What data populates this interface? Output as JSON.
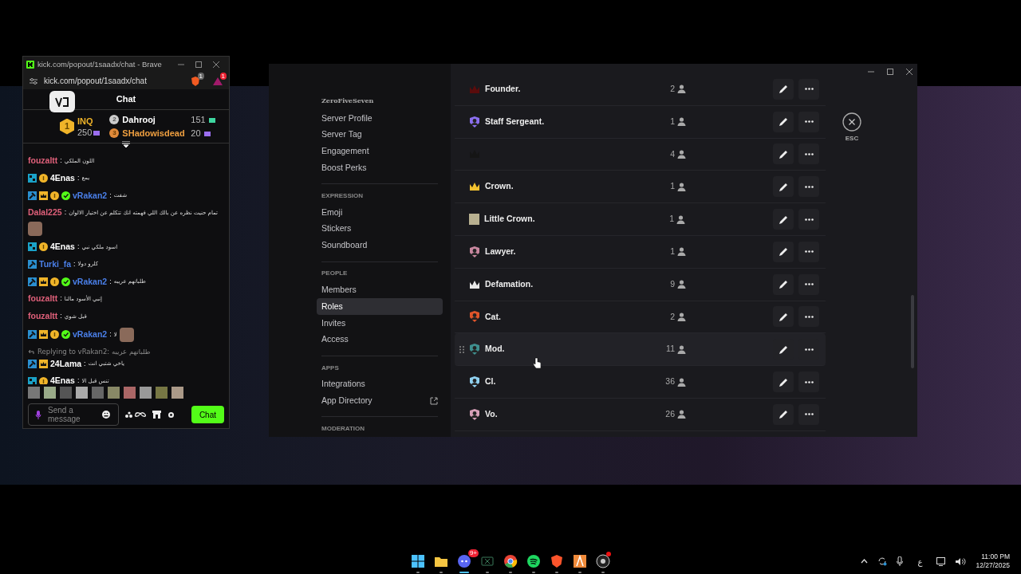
{
  "chat_window": {
    "title": "kick.com/popout/1saadx/chat - Brave",
    "url": "kick.com/popout/1saadx/chat",
    "shield_badge": "1",
    "rewards_badge": "1",
    "header": "Chat",
    "leaderboard": [
      {
        "rank": "1",
        "name": "INQ",
        "points": "250"
      },
      {
        "rank": "2",
        "name": "Dahrooj",
        "points": "151"
      },
      {
        "rank": "3",
        "name": "SHadowisdead",
        "points": "20"
      }
    ],
    "messages": [
      {
        "kind": "message",
        "user": "fouzaltt",
        "separator": ":",
        "color": "#e0607a",
        "text": "اللون الملكي"
      },
      {
        "kind": "message",
        "badges": [
          {
            "kind": "og"
          },
          {
            "kind": "gold"
          }
        ],
        "user": "4Enas",
        "separator": ":",
        "color": "#ffffff",
        "text": "يمع"
      },
      {
        "kind": "message",
        "badges": [
          {
            "kind": "mod"
          },
          {
            "kind": "crown"
          },
          {
            "kind": "gold"
          },
          {
            "kind": "verified"
          }
        ],
        "user": "vRakan2",
        "separator": ":",
        "color": "#4a7fe8",
        "text": "شفت"
      },
      {
        "kind": "message",
        "user": "Dalal225",
        "separator": ":",
        "color": "#e0607a",
        "text": "تمام حنيت نظره عن بالك اللي فهمته انك تتكلم عن اختيار الالوان",
        "emote": true
      },
      {
        "kind": "message",
        "badges": [
          {
            "kind": "og"
          },
          {
            "kind": "gold"
          }
        ],
        "user": "4Enas",
        "separator": ":",
        "color": "#ffffff",
        "text": "اسود ملكي نبي"
      },
      {
        "kind": "message",
        "badges": [
          {
            "kind": "mod"
          }
        ],
        "user": "Turki_fa",
        "separator": ":",
        "color": "#4a7fe8",
        "text": "كلرو دولا"
      },
      {
        "kind": "message",
        "badges": [
          {
            "kind": "mod"
          },
          {
            "kind": "crown"
          },
          {
            "kind": "gold"
          },
          {
            "kind": "verified"
          }
        ],
        "user": "vRakan2",
        "separator": ":",
        "color": "#4a7fe8",
        "text": "طلباتهم عريبه"
      },
      {
        "kind": "message",
        "user": "fouzaltt",
        "separator": ":",
        "color": "#e0607a",
        "text": "إنبي الأسود مالنا"
      },
      {
        "kind": "message",
        "user": "fouzaltt",
        "separator": ":",
        "color": "#e0607a",
        "text": "قبل شوي"
      },
      {
        "kind": "message",
        "badges": [
          {
            "kind": "mod"
          },
          {
            "kind": "crown"
          },
          {
            "kind": "gold"
          },
          {
            "kind": "verified"
          }
        ],
        "user": "vRakan2",
        "separator": ":",
        "color": "#4a7fe8",
        "text": "لا",
        "emote": true
      },
      {
        "kind": "reply",
        "text": "Replying to vRakan2: طلباتهم عريبه"
      },
      {
        "kind": "message",
        "badges": [
          {
            "kind": "mod"
          },
          {
            "kind": "crown"
          }
        ],
        "user": "24Lama",
        "separator": ":",
        "color": "#ffffff",
        "text": "ياخي شتبي انت"
      },
      {
        "kind": "message",
        "badges": [
          {
            "kind": "og"
          },
          {
            "kind": "gold"
          }
        ],
        "user": "4Enas",
        "separator": ":",
        "color": "#ffffff",
        "text": "تنس قبل الا"
      }
    ],
    "input": {
      "placeholder": "Send a message"
    },
    "send_button": "Chat"
  },
  "settings_window": {
    "server_name": "ZeroFiveSeven",
    "sidebar": [
      {
        "kind": "item",
        "label": "Server Profile",
        "selected": false
      },
      {
        "kind": "item",
        "label": "Server Tag",
        "selected": false
      },
      {
        "kind": "item",
        "label": "Engagement",
        "selected": false
      },
      {
        "kind": "item",
        "label": "Boost Perks",
        "selected": false
      },
      {
        "kind": "divider"
      },
      {
        "kind": "section",
        "label": "EXPRESSION"
      },
      {
        "kind": "item",
        "label": "Emoji",
        "selected": false
      },
      {
        "kind": "item",
        "label": "Stickers",
        "selected": false
      },
      {
        "kind": "item",
        "label": "Soundboard",
        "selected": false
      },
      {
        "kind": "divider"
      },
      {
        "kind": "section",
        "label": "PEOPLE"
      },
      {
        "kind": "item",
        "label": "Members",
        "selected": false
      },
      {
        "kind": "item",
        "label": "Roles",
        "selected": true
      },
      {
        "kind": "item",
        "label": "Invites",
        "selected": false
      },
      {
        "kind": "item",
        "label": "Access",
        "selected": false
      },
      {
        "kind": "divider"
      },
      {
        "kind": "section",
        "label": "APPS"
      },
      {
        "kind": "item",
        "label": "Integrations",
        "selected": false
      },
      {
        "kind": "link",
        "label": "App Directory",
        "selected": false
      },
      {
        "kind": "divider"
      },
      {
        "kind": "section",
        "label": "MODERATION"
      }
    ],
    "roles": [
      {
        "kind": "crown",
        "color": "#5a0c0c",
        "name": "Founder.",
        "members": "2",
        "hovered": false
      },
      {
        "kind": "shield",
        "color": "#8b6ff0",
        "name": "Staff Sergeant.",
        "members": "1",
        "hovered": false
      },
      {
        "kind": "crown",
        "color": "#151515",
        "members": "4",
        "hovered": false
      },
      {
        "kind": "crown",
        "color": "#f2c230",
        "name": "Crown.",
        "members": "1",
        "hovered": false
      },
      {
        "kind": "picture",
        "color": "#b8b090",
        "name": "Little Crown.",
        "members": "1",
        "hovered": false
      },
      {
        "kind": "shield",
        "color": "#c8879f",
        "name": "Lawyer.",
        "members": "1",
        "hovered": false
      },
      {
        "kind": "crown",
        "color": "#e8e8e8",
        "name": "Defamation.",
        "members": "9",
        "hovered": false
      },
      {
        "kind": "shield",
        "color": "#e0552a",
        "name": "Cat.",
        "members": "2",
        "hovered": false
      },
      {
        "kind": "shield",
        "color": "#3f8f8f",
        "name": "Mod.",
        "members": "11",
        "hovered": true
      },
      {
        "kind": "shield",
        "color": "#8fd0f0",
        "name": "Cl.",
        "members": "36",
        "hovered": false
      },
      {
        "kind": "shield",
        "color": "#d8a0b8",
        "name": "Vo.",
        "members": "26",
        "hovered": false
      }
    ],
    "esc_label": "ESC"
  },
  "taskbar": {
    "apps": [
      {
        "kind": "start",
        "active": false
      },
      {
        "kind": "folder",
        "active": false
      },
      {
        "kind": "discord",
        "active": true,
        "badge": "9+"
      },
      {
        "kind": "xbox",
        "active": false
      },
      {
        "kind": "chrome",
        "active": false
      },
      {
        "kind": "spotify",
        "active": false
      },
      {
        "kind": "brave",
        "active": false
      },
      {
        "kind": "orange",
        "active": false
      },
      {
        "kind": "obs",
        "active": false
      }
    ],
    "input_language": "ع",
    "time": "11:00 PM",
    "date": "12/27/2025"
  }
}
